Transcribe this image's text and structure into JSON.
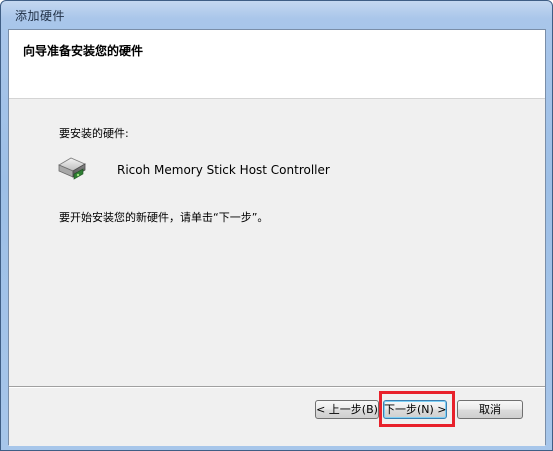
{
  "window": {
    "title": "添加硬件"
  },
  "header": {
    "heading": "向导准备安装您的硬件"
  },
  "body": {
    "install_label": "要安装的硬件:",
    "device_name": "Ricoh Memory Stick Host Controller",
    "device_icon": "hardware-device-icon",
    "instruction": "要开始安装您的新硬件，请单击“下一步”。"
  },
  "buttons": {
    "back_label": "< 上一步(B)",
    "next_label": "下一步(N) >",
    "cancel_label": "取消"
  },
  "colors": {
    "highlight": "#e8212b",
    "titlebar": "#a9c6ea",
    "panel": "#f0f0f0"
  }
}
